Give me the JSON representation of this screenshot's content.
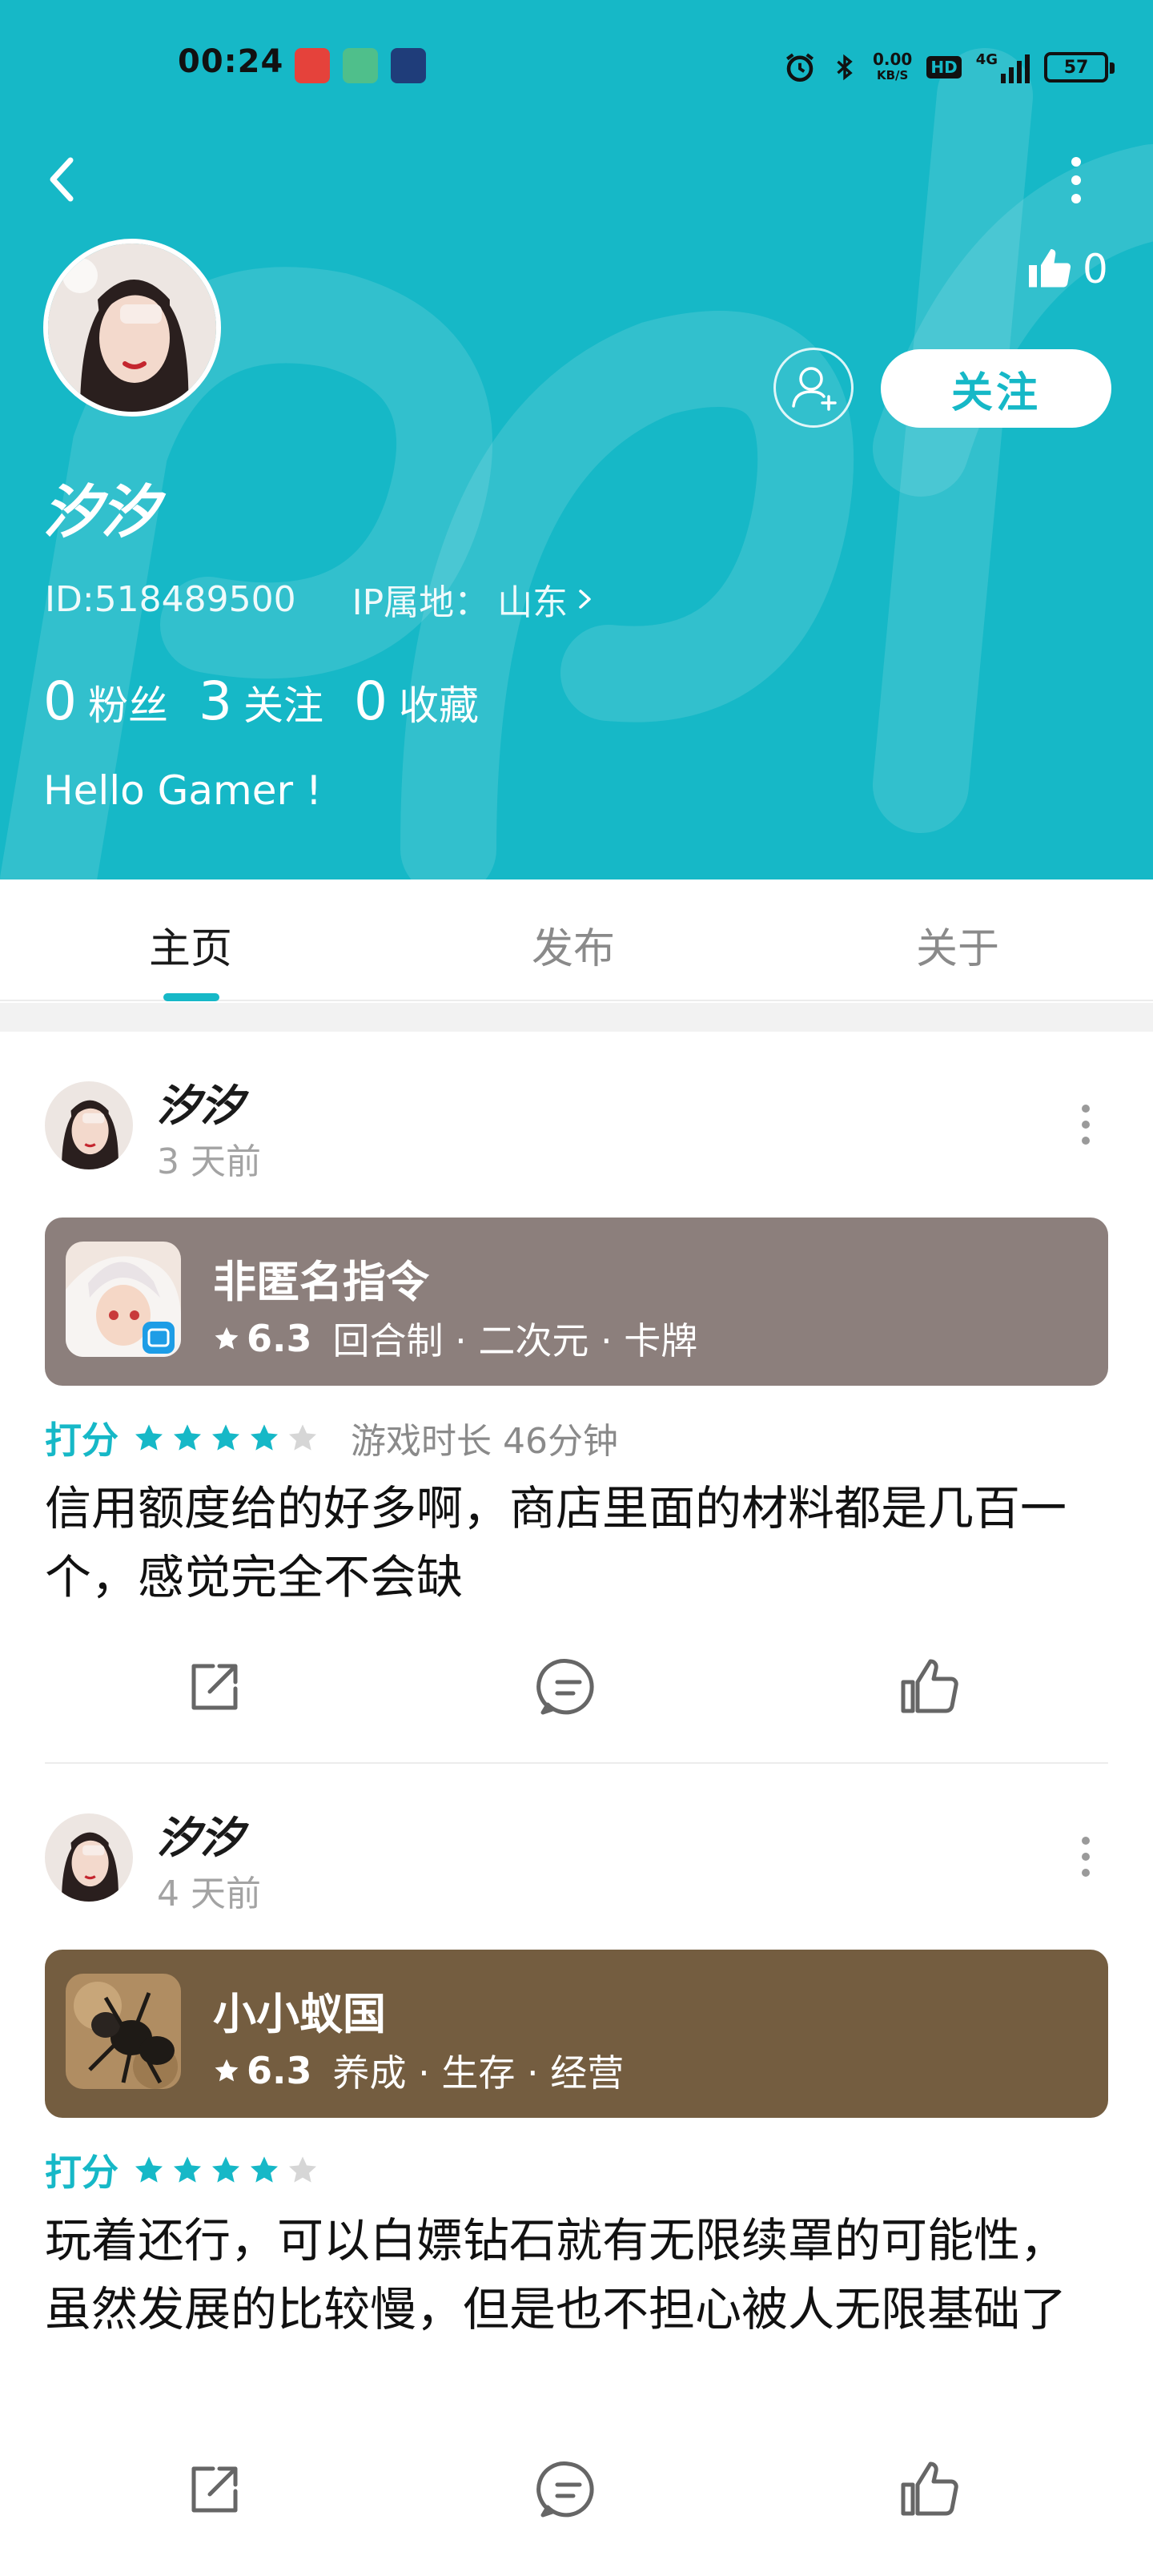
{
  "status_bar": {
    "time": "00:24",
    "net_speed_value": "0.00",
    "net_speed_unit": "KB/S",
    "hd_badge": "HD",
    "signal_label": "4G",
    "battery": "57"
  },
  "profile": {
    "like_count": "0",
    "follow_label": "关注",
    "name": "汐汐",
    "id_text": "ID:518489500",
    "ip_label": "IP属地：",
    "ip_location": "山东",
    "stats": [
      {
        "num": "0",
        "label": "粉丝"
      },
      {
        "num": "3",
        "label": "关注"
      },
      {
        "num": "0",
        "label": "收藏"
      }
    ],
    "bio": "Hello Gamer !"
  },
  "tabs": [
    "主页",
    "发布",
    "关于"
  ],
  "posts": [
    {
      "author": "汐汐",
      "time": "3 天前",
      "game": {
        "title": "非匿名指令",
        "rating": "6.3",
        "tags": "回合制 · 二次元 · 卡牌",
        "card_color": "#8C7F7C"
      },
      "score_label": "打分",
      "stars": 4,
      "playtime": "游戏时长 46分钟",
      "body": "信用额度给的好多啊，商店里面的材料都是几百一个，感觉完全不会缺"
    },
    {
      "author": "汐汐",
      "time": "4 天前",
      "game": {
        "title": "小小蚁国",
        "rating": "6.3",
        "tags": "养成 · 生存 · 经营",
        "card_color": "#745D40"
      },
      "score_label": "打分",
      "stars": 4,
      "playtime": "",
      "body": "玩着还行，可以白嫖钻石就有无限续罩的可能性，虽然发展的比较慢，但是也不担心被人无限基础了"
    }
  ],
  "colors": {
    "accent": "#16B8C7",
    "star_empty": "#D6D6D6"
  },
  "icons": [
    "back-arrow-icon",
    "more-vertical-icon",
    "thumbs-up-icon",
    "add-user-icon",
    "chevron-right-icon",
    "star-icon",
    "share-icon",
    "comment-icon",
    "like-icon"
  ]
}
